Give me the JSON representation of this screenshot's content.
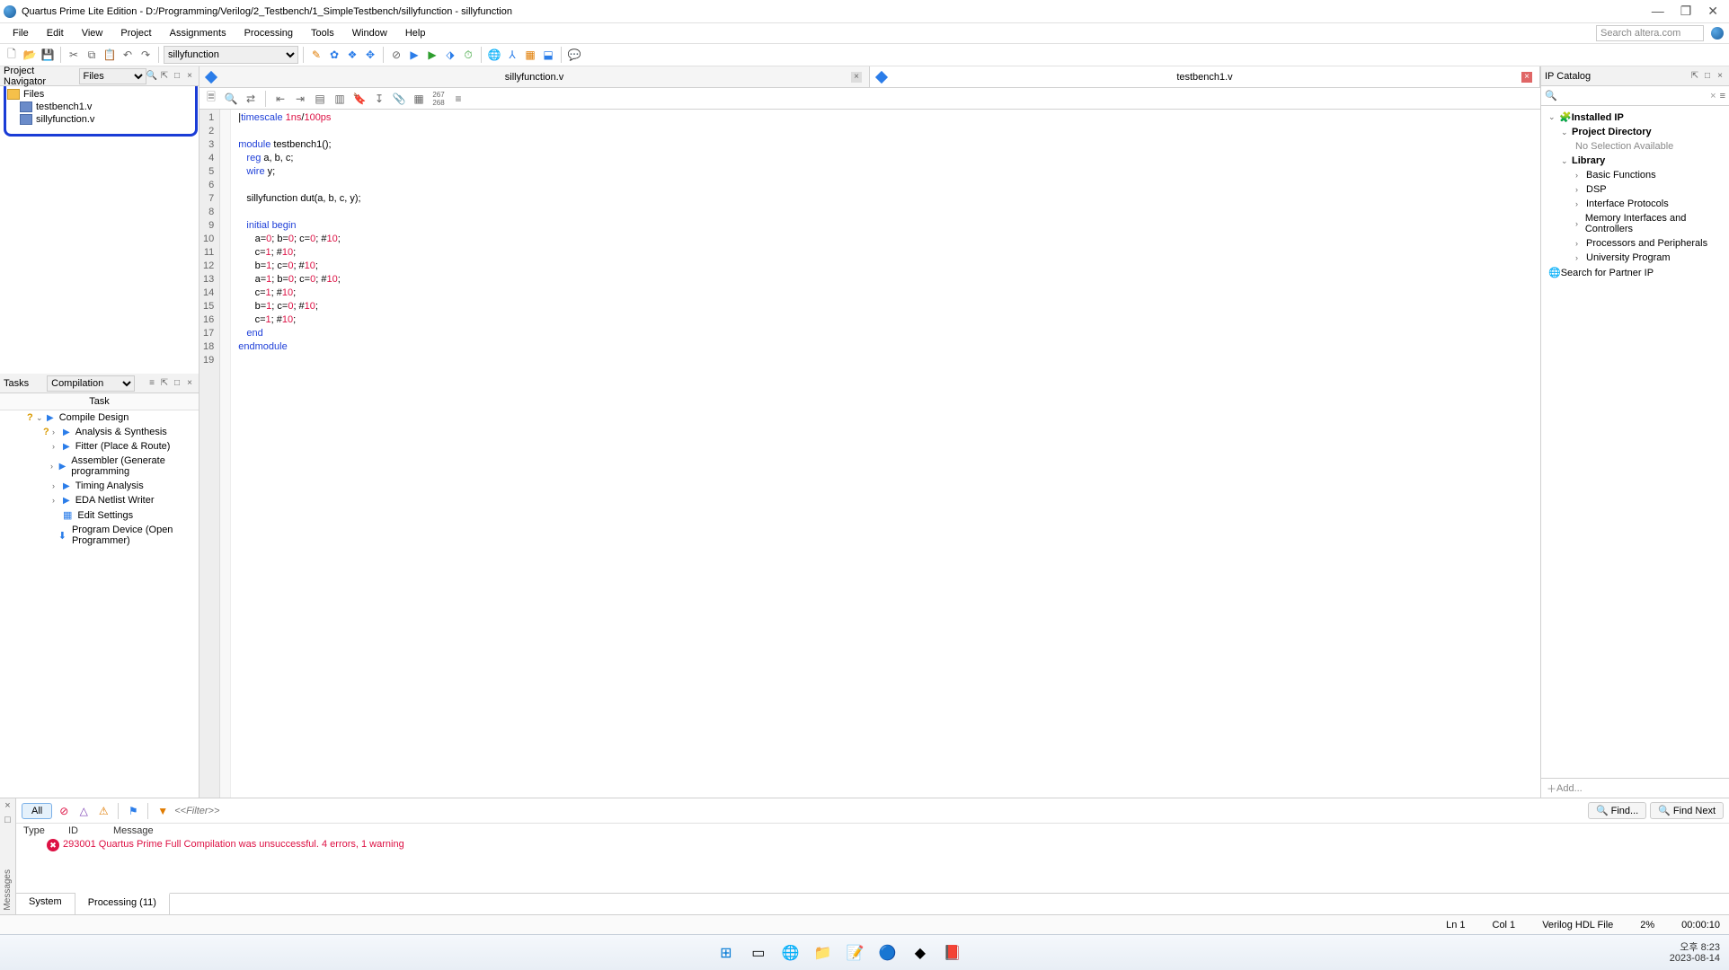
{
  "window": {
    "title": "Quartus Prime Lite Edition - D:/Programming/Verilog/2_Testbench/1_SimpleTestbench/sillyfunction - sillyfunction"
  },
  "menu": [
    "File",
    "Edit",
    "View",
    "Project",
    "Assignments",
    "Processing",
    "Tools",
    "Window",
    "Help"
  ],
  "search_placeholder": "Search altera.com",
  "toolbar_combo": "sillyfunction",
  "nav": {
    "title": "Project Navigator",
    "combo": "Files",
    "root": "Files",
    "files": [
      "testbench1.v",
      "sillyfunction.v"
    ]
  },
  "tasks": {
    "title": "Tasks",
    "combo": "Compilation",
    "header": "Task",
    "items": [
      {
        "label": "Compile Design",
        "level": 1,
        "q": true,
        "expand": "⌄"
      },
      {
        "label": "Analysis & Synthesis",
        "level": 2,
        "q": true,
        "expand": "›"
      },
      {
        "label": "Fitter (Place & Route)",
        "level": 2,
        "expand": "›"
      },
      {
        "label": "Assembler (Generate programming",
        "level": 2,
        "expand": "›"
      },
      {
        "label": "Timing Analysis",
        "level": 2,
        "expand": "›"
      },
      {
        "label": "EDA Netlist Writer",
        "level": 2,
        "expand": "›"
      },
      {
        "label": "Edit Settings",
        "level": 2,
        "icon": "cog"
      },
      {
        "label": "Program Device (Open Programmer)",
        "level": 2,
        "icon": "dl"
      }
    ]
  },
  "tabs": [
    {
      "name": "sillyfunction.v",
      "close": "gray"
    },
    {
      "name": "testbench1.v",
      "close": "red",
      "active": true
    }
  ],
  "code_lines": [
    {
      "n": 1,
      "html": "|<span class='kw'>timescale</span> <span class='num'>1ns</span>/<span class='num'>100ps</span>"
    },
    {
      "n": 2,
      "html": ""
    },
    {
      "n": 3,
      "html": "<span class='kw'>module</span> testbench1();"
    },
    {
      "n": 4,
      "html": "   <span class='kw'>reg</span> a, b, c;"
    },
    {
      "n": 5,
      "html": "   <span class='kw'>wire</span> y;"
    },
    {
      "n": 6,
      "html": ""
    },
    {
      "n": 7,
      "html": "   sillyfunction dut(a, b, c, y);"
    },
    {
      "n": 8,
      "html": ""
    },
    {
      "n": 9,
      "html": "   <span class='kw'>initial</span> <span class='kw'>begin</span>"
    },
    {
      "n": 10,
      "html": "      a=<span class='num'>0</span>; b=<span class='num'>0</span>; c=<span class='num'>0</span>; #<span class='num'>10</span>;"
    },
    {
      "n": 11,
      "html": "      c=<span class='num'>1</span>; #<span class='num'>10</span>;"
    },
    {
      "n": 12,
      "html": "      b=<span class='num'>1</span>; c=<span class='num'>0</span>; #<span class='num'>10</span>;"
    },
    {
      "n": 13,
      "html": "      a=<span class='num'>1</span>; b=<span class='num'>0</span>; c=<span class='num'>0</span>; #<span class='num'>10</span>;"
    },
    {
      "n": 14,
      "html": "      c=<span class='num'>1</span>; #<span class='num'>10</span>;"
    },
    {
      "n": 15,
      "html": "      b=<span class='num'>1</span>; c=<span class='num'>0</span>; #<span class='num'>10</span>;"
    },
    {
      "n": 16,
      "html": "      c=<span class='num'>1</span>; #<span class='num'>10</span>;"
    },
    {
      "n": 17,
      "html": "   <span class='kw'>end</span>"
    },
    {
      "n": 18,
      "html": "<span class='kw'>endmodule</span>"
    },
    {
      "n": 19,
      "html": ""
    }
  ],
  "ip": {
    "title": "IP Catalog",
    "installed": "Installed IP",
    "projdir": "Project Directory",
    "nosel": "No Selection Available",
    "library": "Library",
    "cats": [
      "Basic Functions",
      "DSP",
      "Interface Protocols",
      "Memory Interfaces and Controllers",
      "Processors and Peripherals",
      "University Program"
    ],
    "partner": "Search for Partner IP",
    "add": "Add..."
  },
  "messages": {
    "label": "Messages",
    "all": "All",
    "filter_ph": "<<Filter>>",
    "find": "Find...",
    "findnext": "Find Next",
    "cols": {
      "type": "Type",
      "id": "ID",
      "msg": "Message"
    },
    "row": {
      "id": "293001",
      "text": "Quartus Prime Full Compilation was unsuccessful. 4 errors, 1 warning"
    },
    "tabs": [
      "System",
      "Processing (11)"
    ]
  },
  "status": {
    "ln": "Ln 1",
    "col": "Col 1",
    "ft": "Verilog HDL File",
    "pct": "2%",
    "time": "00:00:10"
  },
  "clock": {
    "t": "오후 8:23",
    "d": "2023-08-14"
  }
}
